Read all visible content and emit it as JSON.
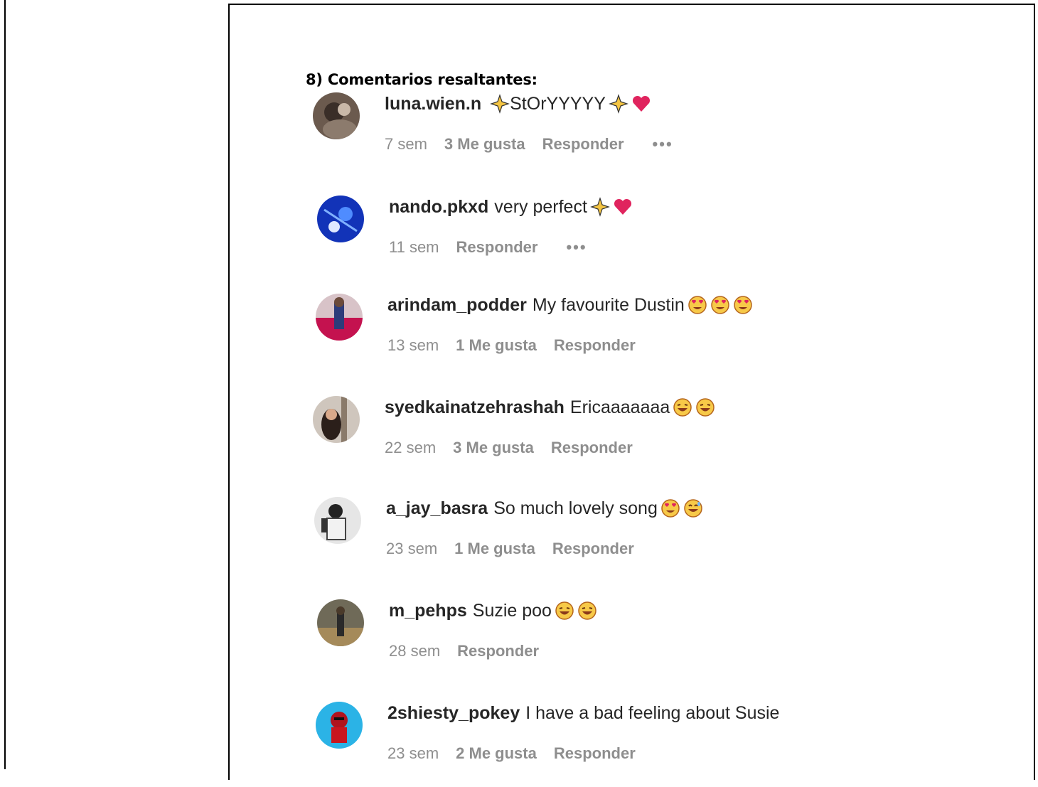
{
  "heading": "8) Comentarios resaltantes:",
  "comments": [
    {
      "user": "luna.wien.n",
      "text": "StOrYYYYY",
      "time": "7 sem",
      "likes": "3 Me gusta",
      "reply": "Responder",
      "more": "•••"
    },
    {
      "user": "nando.pkxd",
      "text": "very perfect",
      "time": "11 sem",
      "likes": "",
      "reply": "Responder",
      "more": "•••"
    },
    {
      "user": "arindam_podder",
      "text": "My favourite Dustin",
      "time": "13 sem",
      "likes": "1 Me gusta",
      "reply": "Responder",
      "more": ""
    },
    {
      "user": "syedkainatzehrashah",
      "text": "Ericaaaaaaa",
      "time": "22 sem",
      "likes": "3 Me gusta",
      "reply": "Responder",
      "more": ""
    },
    {
      "user": "a_jay_basra",
      "text": "So much lovely song",
      "time": "23 sem",
      "likes": "1 Me gusta",
      "reply": "Responder",
      "more": ""
    },
    {
      "user": "m_pehps",
      "text": "Suzie poo",
      "time": "28 sem",
      "likes": "",
      "reply": "Responder",
      "more": ""
    },
    {
      "user": "2shiesty_pokey",
      "text": "I have a bad feeling about Susie",
      "time": "23 sem",
      "likes": "2 Me gusta",
      "reply": "Responder",
      "more": ""
    }
  ],
  "colors": {
    "username": "#262626",
    "meta": "#8e8e8e",
    "heart": "#e0245e",
    "sparkle": "#f5c542"
  }
}
